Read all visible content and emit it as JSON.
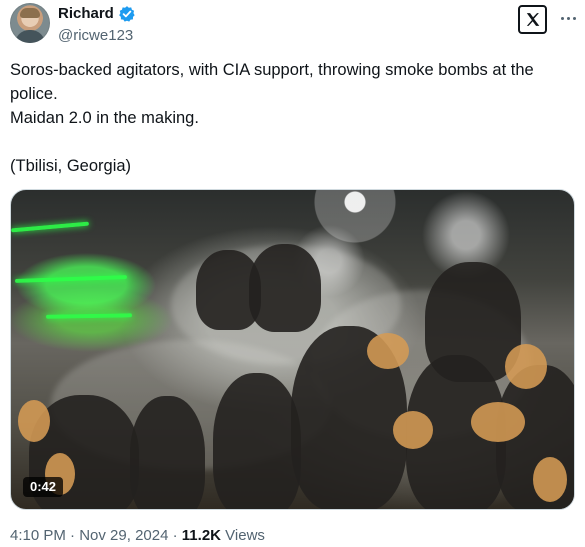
{
  "author": {
    "display_name": "Richard",
    "handle": "@ricwe123",
    "avatar": "avatar",
    "verified_icon": "verified-badge-icon",
    "verified_color": "#1d9bf0"
  },
  "tweet": {
    "text": "Soros-backed agitators, with CIA support, throwing smoke bombs at the police.\nMaidan 2.0 in the making.\n\n(Tbilisi, Georgia)"
  },
  "media": {
    "type": "video",
    "duration": "0:42"
  },
  "meta": {
    "time": "4:10 PM",
    "separator": "·",
    "date": "Nov 29, 2024",
    "views_count": "11.2K",
    "views_label": "Views"
  },
  "icons": {
    "x_logo": "x-logo-icon",
    "more": "more-options-icon"
  }
}
